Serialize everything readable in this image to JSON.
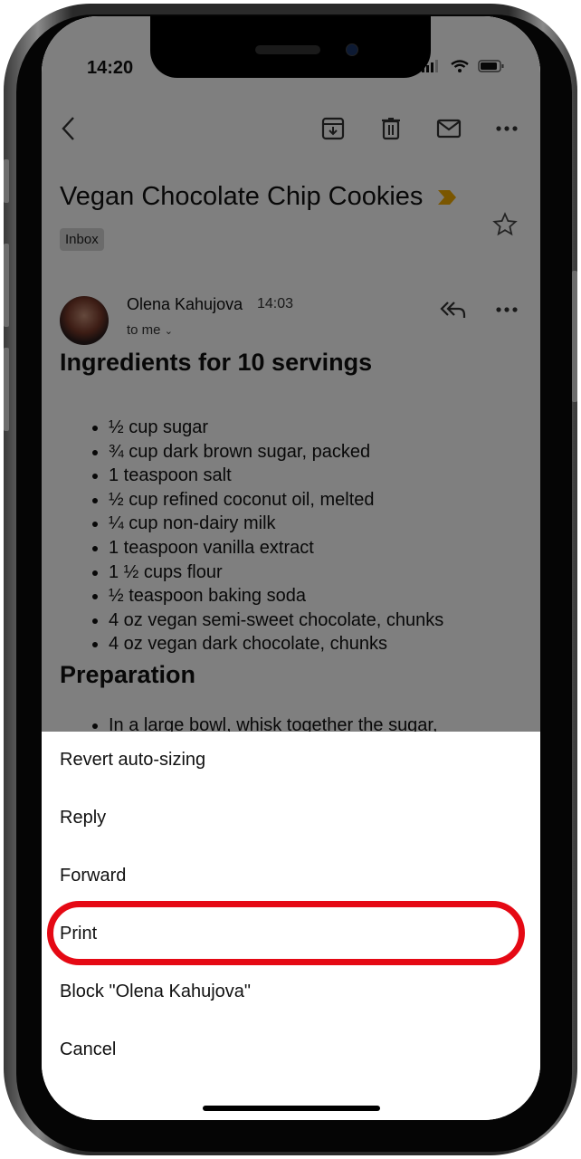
{
  "status_bar": {
    "time": "14:20",
    "icons": [
      "signal-icon",
      "wifi-icon",
      "battery-icon"
    ]
  },
  "toolbar": {
    "icons": [
      "back-chevron-icon",
      "archive-icon",
      "trash-icon",
      "mail-icon",
      "more-icon"
    ]
  },
  "email": {
    "subject": "Vegan Chocolate Chip Cookies",
    "importance_marker_color": "#c48a00",
    "label": "Inbox",
    "sender": "Olena Kahujova",
    "time": "14:03",
    "recipient": "to me",
    "ingredients_heading": "Ingredients for 10 servings",
    "ingredients": [
      "½ cup sugar",
      "¾ cup dark brown sugar, packed",
      "1 teaspoon salt",
      "½ cup refined coconut oil, melted",
      "¼ cup non-dairy milk",
      "1 teaspoon vanilla extract",
      "1 ½ cups flour",
      "½ teaspoon baking soda",
      "4 oz vegan semi-sweet chocolate, chunks",
      "4 oz vegan dark chocolate, chunks"
    ],
    "preparation_heading": "Preparation",
    "preparation": [
      "In a large bowl, whisk together the sugar,"
    ]
  },
  "action_sheet": {
    "items": [
      {
        "label": "Revert auto-sizing"
      },
      {
        "label": "Reply"
      },
      {
        "label": "Forward"
      },
      {
        "label": "Print",
        "highlighted": true
      },
      {
        "label": "Block \"Olena Kahujova\""
      },
      {
        "label": "Cancel"
      }
    ],
    "highlight_color": "#e50914"
  }
}
